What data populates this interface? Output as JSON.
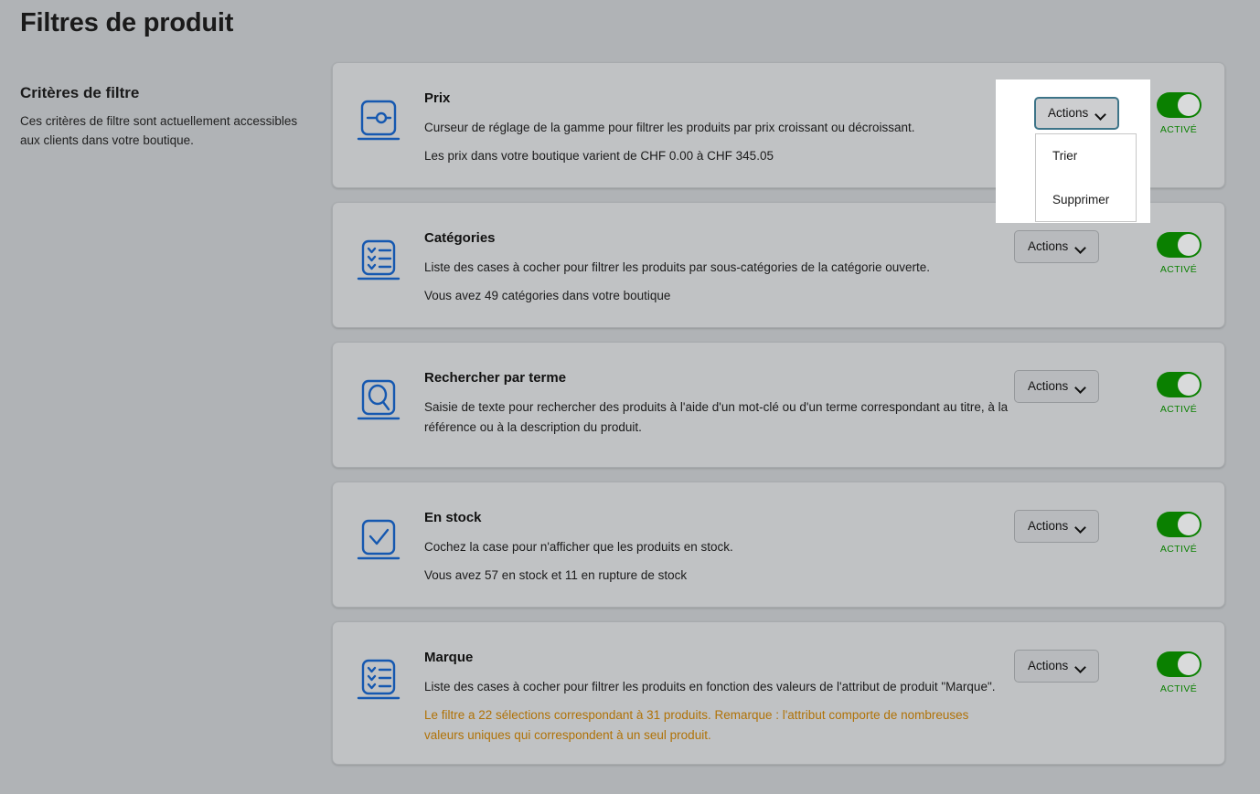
{
  "header": {
    "title": "Filtres de produit"
  },
  "sidebar": {
    "section_title": "Critères de filtre",
    "section_description": "Ces critères de filtre sont actuellement accessibles aux clients dans votre boutique."
  },
  "common": {
    "actions_label": "Actions",
    "toggle_label": "ACTIVÉ"
  },
  "dropdown": {
    "button_label": "Actions",
    "items": [
      {
        "label": "Trier"
      },
      {
        "label": "Supprimer"
      }
    ]
  },
  "colors": {
    "page_background": "#b0b3b6",
    "card_background": "#c0c2c4",
    "icon_blue": "#1558b0",
    "toggle_green": "#0a8000",
    "warning_amber": "#b07207",
    "focus_border": "#3d7488"
  },
  "filters": [
    {
      "icon": "price-slider-icon",
      "name": "Prix",
      "description": "Curseur de réglage de la gamme pour filtrer les produits par prix croissant ou décroissant.",
      "meta": "Les prix dans votre boutique varient de CHF 0.00 à CHF 345.05",
      "warning": "",
      "actions_label": "Actions",
      "toggle_label": "ACTIVÉ",
      "toggle_on": true
    },
    {
      "icon": "checklist-icon",
      "name": "Catégories",
      "description": "Liste des cases à cocher pour filtrer les produits par sous-catégories de la catégorie ouverte.",
      "meta": "Vous avez 49 catégories dans votre boutique",
      "warning": "",
      "actions_label": "Actions",
      "toggle_label": "ACTIVÉ",
      "toggle_on": true
    },
    {
      "icon": "search-icon",
      "name": "Rechercher par terme",
      "description": "Saisie de texte pour rechercher des produits à l'aide d'un mot-clé ou d'un terme correspondant au titre, à la référence ou à la description du produit.",
      "meta": "",
      "warning": "",
      "actions_label": "Actions",
      "toggle_label": "ACTIVÉ",
      "toggle_on": true
    },
    {
      "icon": "checkbox-check-icon",
      "name": "En stock",
      "description": "Cochez la case pour n'afficher que les produits en stock.",
      "meta": "Vous avez 57 en stock et 11 en rupture de stock",
      "warning": "",
      "actions_label": "Actions",
      "toggle_label": "ACTIVÉ",
      "toggle_on": true
    },
    {
      "icon": "checklist-icon",
      "name": "Marque",
      "description": "Liste des cases à cocher pour filtrer les produits en fonction des valeurs de l'attribut de produit \"Marque\".",
      "meta": "",
      "warning": "Le filtre a 22 sélections correspondant à 31 produits. Remarque : l'attribut comporte de nombreuses valeurs uniques qui correspondent à un seul produit.",
      "actions_label": "Actions",
      "toggle_label": "ACTIVÉ",
      "toggle_on": true
    }
  ]
}
